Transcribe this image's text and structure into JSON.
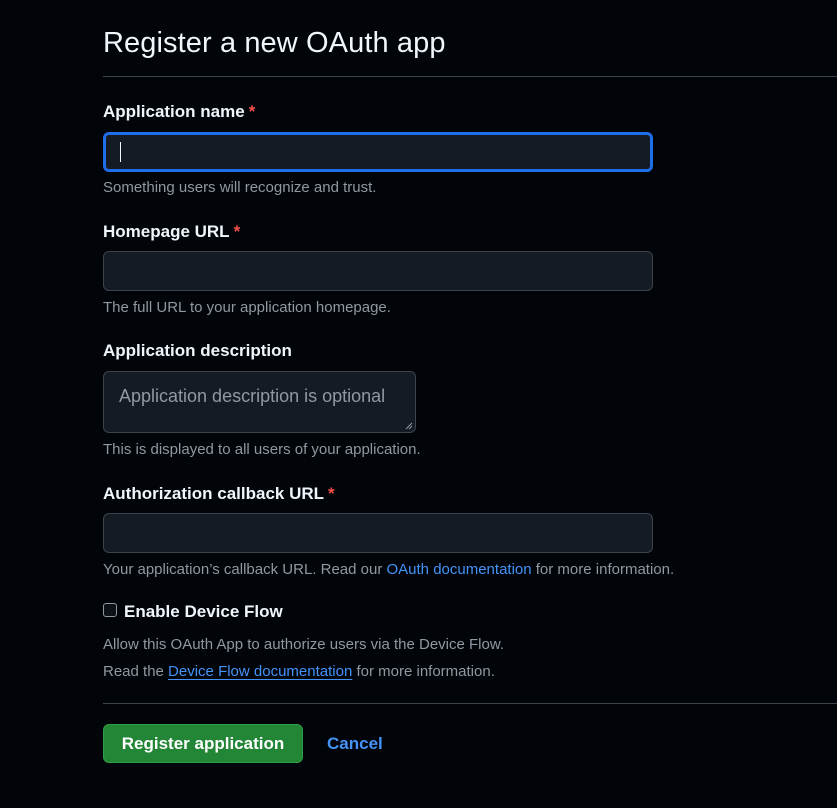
{
  "page": {
    "title": "Register a new OAuth app"
  },
  "form": {
    "app_name": {
      "label": "Application name",
      "required_mark": "*",
      "value": "",
      "help": "Something users will recognize and trust."
    },
    "homepage_url": {
      "label": "Homepage URL",
      "required_mark": "*",
      "value": "",
      "help": "The full URL to your application homepage."
    },
    "description": {
      "label": "Application description",
      "placeholder": "Application description is optional",
      "help": "This is displayed to all users of your application."
    },
    "callback_url": {
      "label": "Authorization callback URL",
      "required_mark": "*",
      "value": "",
      "help_prefix": "Your application’s callback URL. Read our ",
      "help_link": "OAuth documentation",
      "help_suffix": " for more information."
    },
    "device_flow": {
      "label": "Enable Device Flow",
      "checked": false,
      "help_line1": "Allow this OAuth App to authorize users via the Device Flow.",
      "help_line2_prefix": "Read the ",
      "help_line2_link": "Device Flow documentation",
      "help_line2_suffix": " for more information."
    }
  },
  "actions": {
    "submit_label": "Register application",
    "cancel_label": "Cancel"
  },
  "colors": {
    "background": "#010409",
    "accent": "#1f6feb",
    "link": "#4493f8",
    "primary_button": "#238636",
    "required": "#f85149"
  }
}
